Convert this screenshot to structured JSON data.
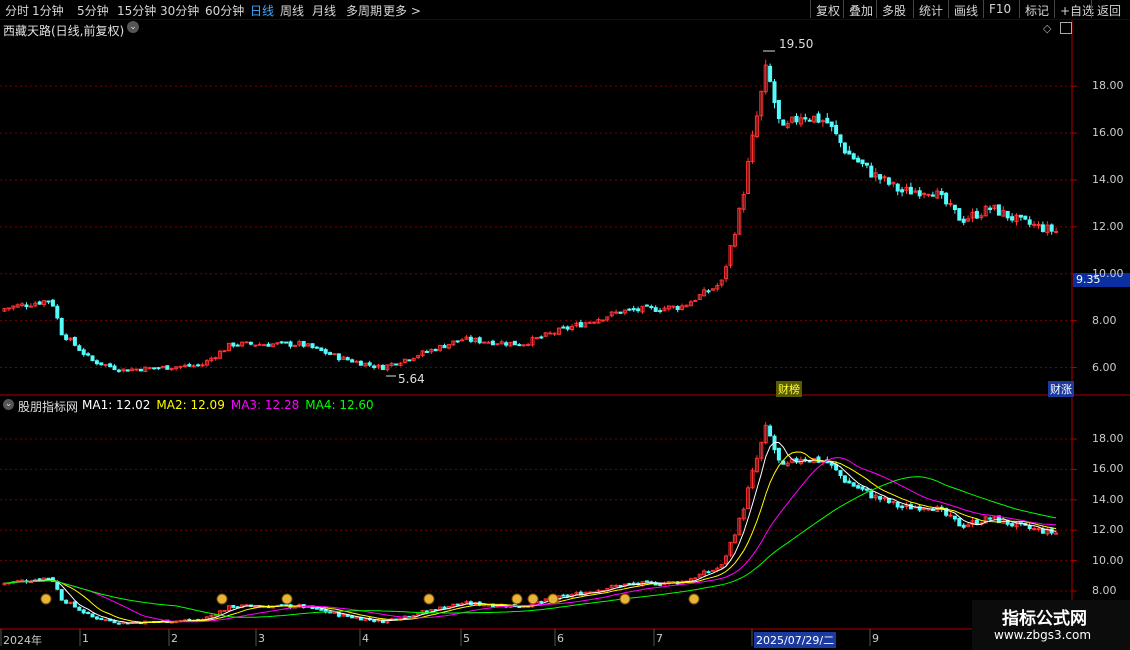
{
  "toolbar": {
    "periods": [
      "分时",
      "1分钟",
      "5分钟",
      "15分钟",
      "30分钟",
      "60分钟",
      "日线",
      "周线",
      "月线",
      "多周期",
      "更多 >"
    ],
    "active_period": "日线",
    "right_buttons": [
      "复权",
      "叠加",
      "多股",
      "统计",
      "画线",
      "F10",
      "标记",
      "+自选",
      "返回"
    ]
  },
  "main_panel": {
    "title": "西藏天路(日线,前复权)",
    "y_ticks": [
      "18.00",
      "16.00",
      "14.00",
      "12.00",
      "10.00",
      "8.00",
      "6.00"
    ],
    "current_price": "9.35",
    "high_label": "19.50",
    "low_label": "5.64",
    "badge_1": "财榜",
    "badge_2": "财涨"
  },
  "indicator_panel": {
    "name": "股朋指标网",
    "ma": [
      {
        "label": "MA1:",
        "value": "12.02",
        "color": "#ffffff"
      },
      {
        "label": "MA2:",
        "value": "12.09",
        "color": "#ffff00"
      },
      {
        "label": "MA3:",
        "value": "12.28",
        "color": "#ff00ff"
      },
      {
        "label": "MA4:",
        "value": "12.60",
        "color": "#00ff00"
      }
    ],
    "y_ticks": [
      "18.00",
      "16.00",
      "14.00",
      "12.00",
      "10.00",
      "8.00"
    ]
  },
  "x_axis": {
    "labels": [
      "2024年",
      "1",
      "2",
      "3",
      "4",
      "5",
      "6",
      "7",
      "2025/07/29/二",
      "9"
    ]
  },
  "watermark": {
    "title": "指标公式网",
    "url": "www.zbgs3.com"
  },
  "colors": {
    "up": "#ff3232",
    "down": "#54fcfc",
    "grid": "#7a0000",
    "axis": "#b00000",
    "ma1": "#ffffff",
    "ma2": "#ffff00",
    "ma3": "#ff00ff",
    "ma4": "#00ff00"
  },
  "chart_data": {
    "type": "candlestick",
    "price_anchor_series": [
      {
        "t": 0,
        "close": 8.5
      },
      {
        "t": 50,
        "close": 8.9
      },
      {
        "t": 60,
        "close": 7.5
      },
      {
        "t": 90,
        "close": 6.3
      },
      {
        "t": 120,
        "close": 5.9
      },
      {
        "t": 200,
        "close": 6.1
      },
      {
        "t": 230,
        "close": 7.0
      },
      {
        "t": 300,
        "close": 7.0
      },
      {
        "t": 340,
        "close": 6.4
      },
      {
        "t": 380,
        "close": 6.0
      },
      {
        "t": 420,
        "close": 6.6
      },
      {
        "t": 460,
        "close": 7.2
      },
      {
        "t": 520,
        "close": 7.0
      },
      {
        "t": 560,
        "close": 7.6
      },
      {
        "t": 620,
        "close": 8.4
      },
      {
        "t": 680,
        "close": 8.6
      },
      {
        "t": 720,
        "close": 9.6
      },
      {
        "t": 740,
        "close": 13.0
      },
      {
        "t": 750,
        "close": 15.5
      },
      {
        "t": 765,
        "close": 18.8
      },
      {
        "t": 780,
        "close": 16.0
      },
      {
        "t": 800,
        "close": 16.8
      },
      {
        "t": 825,
        "close": 16.5
      },
      {
        "t": 845,
        "close": 15.2
      },
      {
        "t": 870,
        "close": 14.3
      },
      {
        "t": 900,
        "close": 13.5
      },
      {
        "t": 930,
        "close": 13.6
      },
      {
        "t": 960,
        "close": 12.3
      },
      {
        "t": 990,
        "close": 12.8
      },
      {
        "t": 1020,
        "close": 12.2
      },
      {
        "t": 1055,
        "close": 11.8
      }
    ],
    "price_high": 19.5,
    "price_low": 5.64,
    "y_range_main": [
      5.0,
      20.0
    ],
    "y_range_indicator": [
      7.5,
      20.0
    ]
  }
}
